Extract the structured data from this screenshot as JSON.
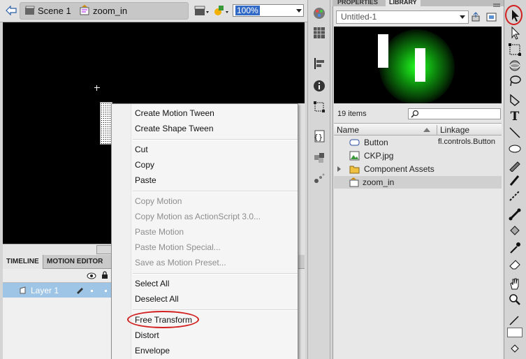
{
  "header": {
    "scene_label": "Scene 1",
    "symbol_label": "zoom_in",
    "zoom_value": "100%"
  },
  "timeline": {
    "tabs": [
      "TIMELINE",
      "MOTION EDITOR"
    ],
    "layer_name": "Layer 1"
  },
  "context_menu": {
    "groups": [
      [
        {
          "label": "Create Motion Tween",
          "enabled": true
        },
        {
          "label": "Create Shape Tween",
          "enabled": true
        }
      ],
      [
        {
          "label": "Cut",
          "enabled": true
        },
        {
          "label": "Copy",
          "enabled": true
        },
        {
          "label": "Paste",
          "enabled": true
        }
      ],
      [
        {
          "label": "Copy Motion",
          "enabled": false
        },
        {
          "label": "Copy Motion as ActionScript 3.0...",
          "enabled": false
        },
        {
          "label": "Paste Motion",
          "enabled": false
        },
        {
          "label": "Paste Motion Special...",
          "enabled": false
        },
        {
          "label": "Save as Motion Preset...",
          "enabled": false
        }
      ],
      [
        {
          "label": "Select All",
          "enabled": true
        },
        {
          "label": "Deselect All",
          "enabled": true
        }
      ],
      [
        {
          "label": "Free Transform",
          "enabled": true,
          "highlighted": true
        },
        {
          "label": "Distort",
          "enabled": true
        },
        {
          "label": "Envelope",
          "enabled": true
        }
      ]
    ]
  },
  "library": {
    "tabs": [
      "PROPERTIES",
      "LIBRARY"
    ],
    "document": "Untitled-1",
    "item_count": "19 items",
    "columns": [
      "Name",
      "Linkage"
    ],
    "items": [
      {
        "name": "Button",
        "linkage": "fl.controls.Button",
        "icon": "button-symbol-icon"
      },
      {
        "name": "CKP.jpg",
        "linkage": "",
        "icon": "bitmap-icon"
      },
      {
        "name": "Component Assets",
        "linkage": "",
        "icon": "folder-icon",
        "expandable": true
      },
      {
        "name": "zoom_in",
        "linkage": "",
        "icon": "movieclip-icon",
        "selected": true
      }
    ]
  },
  "tools": [
    "selection-tool-icon",
    "subselection-tool-icon",
    "free-transform-tool-icon",
    "3d-rotation-tool-icon",
    "lasso-tool-icon",
    "pen-tool-icon",
    "text-tool-icon",
    "line-tool-icon",
    "oval-tool-icon",
    "pencil-tool-icon",
    "brush-tool-icon",
    "deco-tool-icon",
    "bone-tool-icon",
    "paint-bucket-tool-icon",
    "eyedropper-tool-icon",
    "eraser-tool-icon",
    "hand-tool-icon",
    "zoom-tool-icon",
    "stroke-color-icon",
    "fill-color-icon"
  ],
  "colors": {
    "annotation": "#d21f1f",
    "selection": "#9ec4e6",
    "stage": "#000000"
  }
}
